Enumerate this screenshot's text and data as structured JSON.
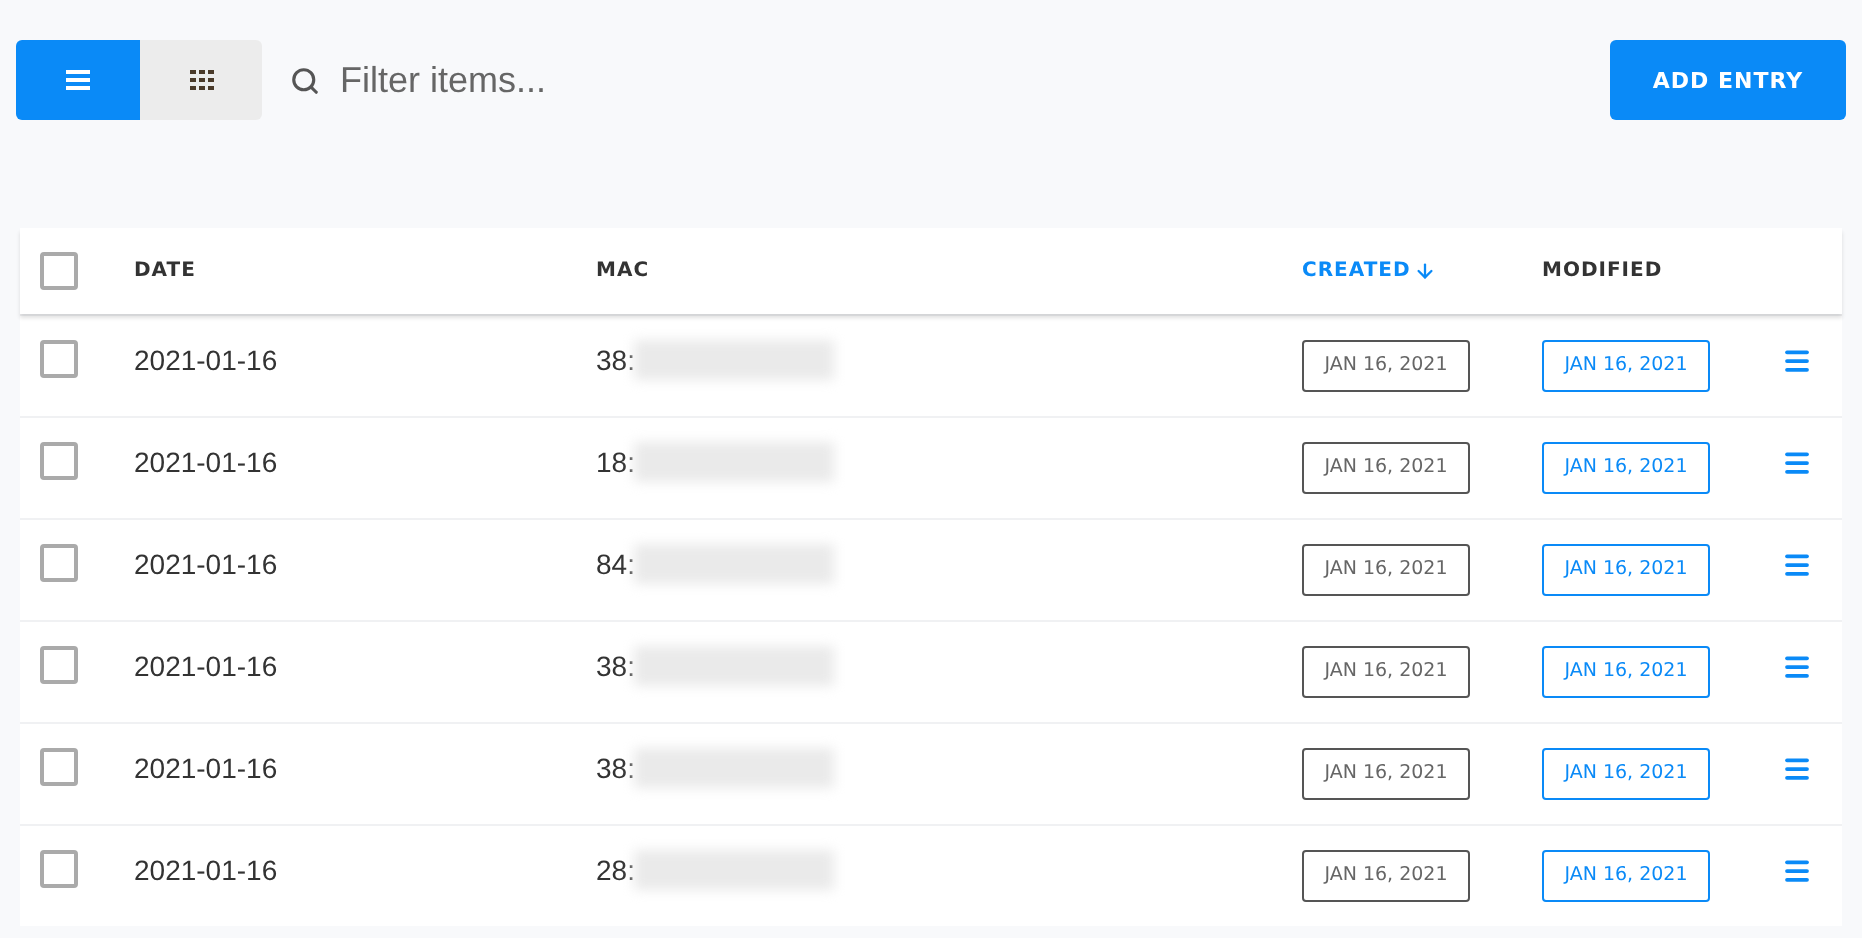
{
  "view_toggle": [
    {
      "kind": "list",
      "selected": true
    },
    {
      "kind": "grid",
      "selected": false
    }
  ],
  "filter": {
    "placeholder": "Filter items..."
  },
  "add_button": "ADD ENTRY",
  "table": {
    "select_all": {
      "checked": false
    },
    "columns": [
      {
        "label": "DATE",
        "sorted": false
      },
      {
        "label": "MAC",
        "sorted": false
      },
      {
        "label": "CREATED",
        "sorted": true
      },
      {
        "label": "MODIFIED",
        "sorted": false
      }
    ],
    "rows": [
      {
        "checked": false,
        "date": "2021-01-16",
        "mac": "38:",
        "created": "JAN 16, 2021",
        "modified": "JAN 16, 2021"
      },
      {
        "checked": false,
        "date": "2021-01-16",
        "mac": "18:",
        "created": "JAN 16, 2021",
        "modified": "JAN 16, 2021"
      },
      {
        "checked": false,
        "date": "2021-01-16",
        "mac": "84:",
        "created": "JAN 16, 2021",
        "modified": "JAN 16, 2021"
      },
      {
        "checked": false,
        "date": "2021-01-16",
        "mac": "38:",
        "created": "JAN 16, 2021",
        "modified": "JAN 16, 2021"
      },
      {
        "checked": false,
        "date": "2021-01-16",
        "mac": "38:",
        "created": "JAN 16, 2021",
        "modified": "JAN 16, 2021"
      },
      {
        "checked": false,
        "date": "2021-01-16",
        "mac": "28:",
        "created": "JAN 16, 2021",
        "modified": "JAN 16, 2021"
      }
    ]
  }
}
